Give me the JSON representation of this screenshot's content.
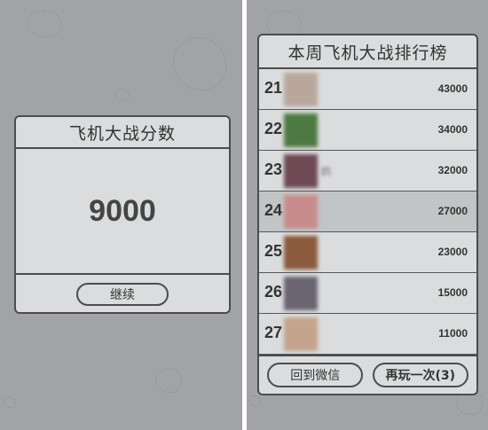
{
  "score_screen": {
    "title": "飞机大战分数",
    "score": "9000",
    "continue_label": "继续"
  },
  "leaderboard": {
    "title": "本周飞机大战排行榜",
    "rows": [
      {
        "rank": "21",
        "name": "",
        "score": "43000",
        "avatar_color": "#b9a79c"
      },
      {
        "rank": "22",
        "name": "",
        "score": "34000",
        "avatar_color": "#4d7a42"
      },
      {
        "rank": "23",
        "name": "鸥",
        "score": "32000",
        "avatar_color": "#6e4a55"
      },
      {
        "rank": "24",
        "name": "",
        "score": "27000",
        "avatar_color": "#c88c8c"
      },
      {
        "rank": "25",
        "name": "",
        "score": "23000",
        "avatar_color": "#8c5a3c"
      },
      {
        "rank": "26",
        "name": "",
        "score": "15000",
        "avatar_color": "#6a6472"
      },
      {
        "rank": "27",
        "name": "",
        "score": "11000",
        "avatar_color": "#c4a48c"
      }
    ],
    "current_rank_index": 3,
    "back_label": "回到微信",
    "play_again_label": "再玩一次(3)"
  },
  "colors": {
    "background": "#a2a3a7",
    "panel": "#dadcdd",
    "border": "#4c4c4e",
    "highlight_row": "#c2c5c5"
  }
}
